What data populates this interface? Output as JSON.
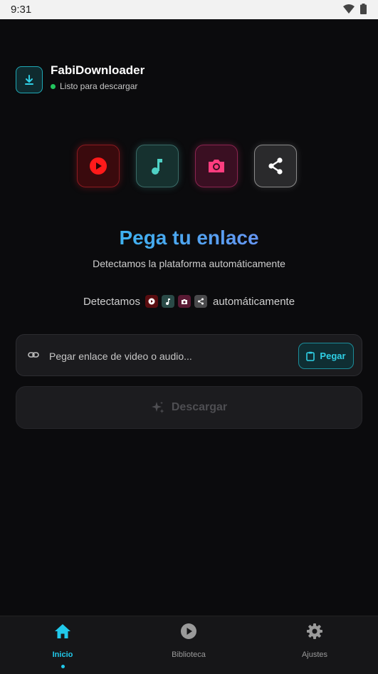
{
  "status_bar": {
    "time": "9:31"
  },
  "header": {
    "title": "FabiDownloader",
    "status": "Listo para descargar"
  },
  "platforms": [
    {
      "name": "youtube",
      "icon": "play-circle-icon",
      "color": "#ff1a1a"
    },
    {
      "name": "music",
      "icon": "music-note-icon",
      "color": "#4fd1c5"
    },
    {
      "name": "instagram",
      "icon": "camera-icon",
      "color": "#ff3d7f"
    },
    {
      "name": "share",
      "icon": "share-icon",
      "color": "#ffffff"
    }
  ],
  "hero": {
    "title": "Pega tu enlace",
    "subtitle": "Detectamos la plataforma automáticamente",
    "detect_lead": "Detectamos",
    "detect_tail": "automáticamente"
  },
  "input": {
    "placeholder": "Pegar enlace de video o audio...",
    "value": "",
    "paste_label": "Pegar"
  },
  "download": {
    "label": "Descargar"
  },
  "nav": {
    "items": [
      {
        "label": "Inicio",
        "icon": "home-icon",
        "active": true
      },
      {
        "label": "Biblioteca",
        "icon": "play-circle-icon",
        "active": false
      },
      {
        "label": "Ajustes",
        "icon": "gear-icon",
        "active": false
      }
    ]
  },
  "colors": {
    "accent": "#21c9ea",
    "background": "#0b0b0d",
    "status_green": "#22c55e"
  }
}
